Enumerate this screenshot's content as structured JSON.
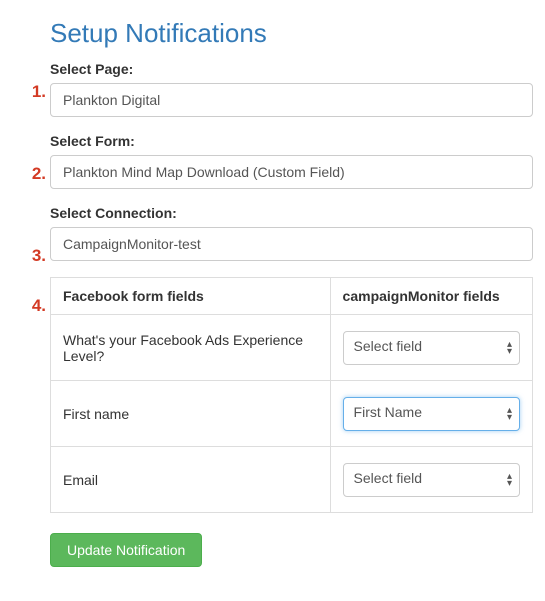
{
  "title": "Setup Notifications",
  "steps": {
    "n1": "1.",
    "n2": "2.",
    "n3": "3.",
    "n4": "4."
  },
  "fields": {
    "page": {
      "label": "Select Page:",
      "value": "Plankton Digital"
    },
    "form": {
      "label": "Select Form:",
      "value": "Plankton Mind Map Download (Custom Field)"
    },
    "connection": {
      "label": "Select Connection:",
      "value": "CampaignMonitor-test"
    }
  },
  "table": {
    "header_left": "Facebook form fields",
    "header_right": "campaignMonitor fields",
    "rows": [
      {
        "facebook": "What's your Facebook Ads Experience Level?",
        "mapped": "Select field",
        "active": false
      },
      {
        "facebook": "First name",
        "mapped": "First Name",
        "active": true
      },
      {
        "facebook": "Email",
        "mapped": "Select field",
        "active": false
      }
    ]
  },
  "button": {
    "update": "Update Notification"
  }
}
